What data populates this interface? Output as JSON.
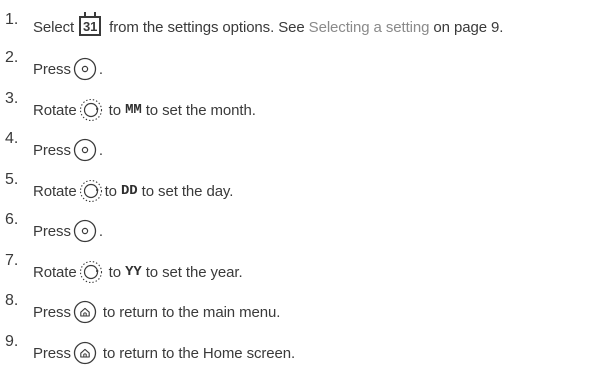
{
  "steps": [
    {
      "num": "1.",
      "pre": "Select",
      "icon_label": "31",
      "post": " from the settings options. See ",
      "link": "Selecting a setting",
      "tail": " on page 9."
    },
    {
      "num": "2.",
      "pre": "Press",
      "post": "."
    },
    {
      "num": "3.",
      "pre": "Rotate",
      "mid": " to ",
      "code": "MM",
      "post": " to set the month."
    },
    {
      "num": "4.",
      "pre": "Press",
      "post": "."
    },
    {
      "num": "5.",
      "pre": "Rotate",
      "mid": "to ",
      "code": "DD",
      "post": " to set the day."
    },
    {
      "num": "6.",
      "pre": "Press",
      "post": "."
    },
    {
      "num": "7.",
      "pre": "Rotate",
      "mid": " to ",
      "code": "YY",
      "post": " to set the year."
    },
    {
      "num": "8.",
      "pre": "Press",
      "post": " to return to the main menu."
    },
    {
      "num": "9.",
      "pre": "Press",
      "post": " to return to the Home screen."
    }
  ],
  "icons": {
    "step1": "calendar-icon",
    "press_button": "select-button-icon",
    "rotate_dial": "rotary-dial-icon",
    "home_button": "home-button-icon"
  },
  "colors": {
    "text": "#3a3a3a",
    "link": "#8a8a8a"
  }
}
